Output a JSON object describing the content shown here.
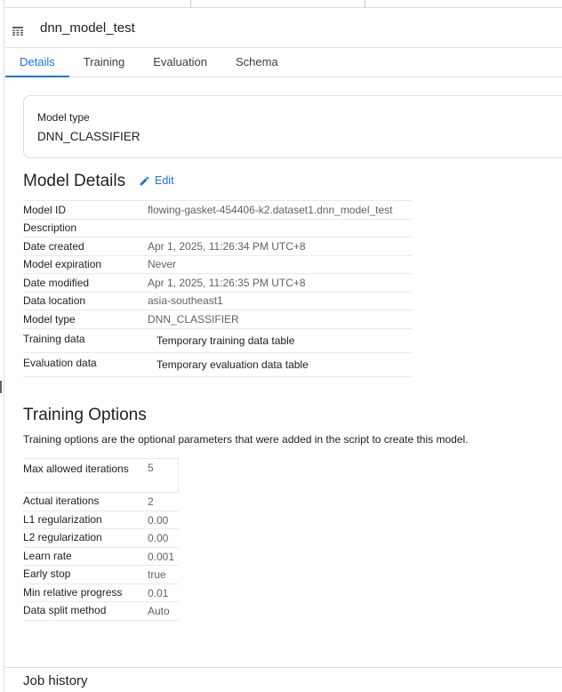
{
  "header": {
    "model_name": "dnn_model_test",
    "icon": "table-grid-icon"
  },
  "tabs": [
    {
      "label": "Details",
      "active": true
    },
    {
      "label": "Training",
      "active": false
    },
    {
      "label": "Evaluation",
      "active": false
    },
    {
      "label": "Schema",
      "active": false
    }
  ],
  "model_type_card": {
    "label": "Model type",
    "value": "DNN_CLASSIFIER"
  },
  "model_details": {
    "title": "Model Details",
    "edit_label": "Edit",
    "rows": [
      {
        "key": "Model ID",
        "value": "flowing-gasket-454406-k2.dataset1.dnn_model_test"
      },
      {
        "key": "Description",
        "value": ""
      },
      {
        "key": "Date created",
        "value": "Apr 1, 2025, 11:26:34 PM UTC+8"
      },
      {
        "key": "Model expiration",
        "value": "Never"
      },
      {
        "key": "Date modified",
        "value": "Apr 1, 2025, 11:26:35 PM UTC+8"
      },
      {
        "key": "Data location",
        "value": "asia-southeast1"
      },
      {
        "key": "Model type",
        "value": "DNN_CLASSIFIER"
      },
      {
        "key": "Training data",
        "value": "Temporary training data table"
      },
      {
        "key": "Evaluation data",
        "value": "Temporary evaluation data table"
      }
    ]
  },
  "training_options": {
    "title": "Training Options",
    "description": "Training options are the optional parameters that were added in the script to create this model.",
    "rows": [
      {
        "key": "Max allowed iterations",
        "value": "5"
      },
      {
        "key": "Actual iterations",
        "value": "2"
      },
      {
        "key": "L1 regularization",
        "value": "0.00"
      },
      {
        "key": "L2 regularization",
        "value": "0.00"
      },
      {
        "key": "Learn rate",
        "value": "0.001"
      },
      {
        "key": "Early stop",
        "value": "true"
      },
      {
        "key": "Min relative progress",
        "value": "0.01"
      },
      {
        "key": "Data split method",
        "value": "Auto"
      }
    ]
  },
  "job_history": {
    "title": "Job history"
  },
  "colors": {
    "accent": "#1a73e8",
    "text": "#202124",
    "muted": "#5f6368",
    "border": "#dadce0"
  }
}
